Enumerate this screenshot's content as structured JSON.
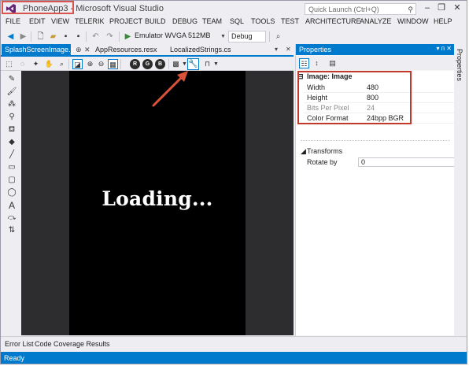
{
  "window": {
    "title": "PhoneApp3 - Microsoft Visual Studio",
    "quick_launch_placeholder": "Quick Launch (Ctrl+Q)",
    "controls": [
      "–",
      "❐",
      "✕"
    ]
  },
  "menu": [
    "FILE",
    "EDIT",
    "VIEW",
    "TELERIK",
    "PROJECT",
    "BUILD",
    "DEBUG",
    "TEAM",
    "SQL",
    "TOOLS",
    "TEST",
    "ARCHITECTURE",
    "ANALYZE",
    "WINDOW",
    "HELP"
  ],
  "toolbar": {
    "emulator": "Emulator WVGA 512MB",
    "configuration": "Debug"
  },
  "doc_tabs": {
    "active": "SplashScreenImage.jpg",
    "others": [
      "AppResources.resx",
      "LocalizedStrings.cs"
    ]
  },
  "image_editor": {
    "channel_buttons": [
      "R",
      "G",
      "B"
    ]
  },
  "canvas": {
    "text": "Loading..."
  },
  "properties": {
    "title": "Properties",
    "header_controls": "▾ ᴨ ✕",
    "category_image": "Image: Image",
    "rows": [
      {
        "name": "Width",
        "value": "480",
        "dim": false
      },
      {
        "name": "Height",
        "value": "800",
        "dim": false
      },
      {
        "name": "Bits Per Pixel",
        "value": "24",
        "dim": true
      },
      {
        "name": "Color Format",
        "value": "24bpp BGR",
        "dim": false
      }
    ],
    "category_transforms": "Transforms",
    "rotate_label": "Rotate by",
    "rotate_value": "0",
    "side_tab": "Properties"
  },
  "bottom_tabs": [
    "Error List",
    "Code Coverage Results"
  ],
  "status": "Ready",
  "colors": {
    "accent": "#007acc",
    "highlight_border": "#c0392b",
    "arrow": "#d9533b"
  }
}
